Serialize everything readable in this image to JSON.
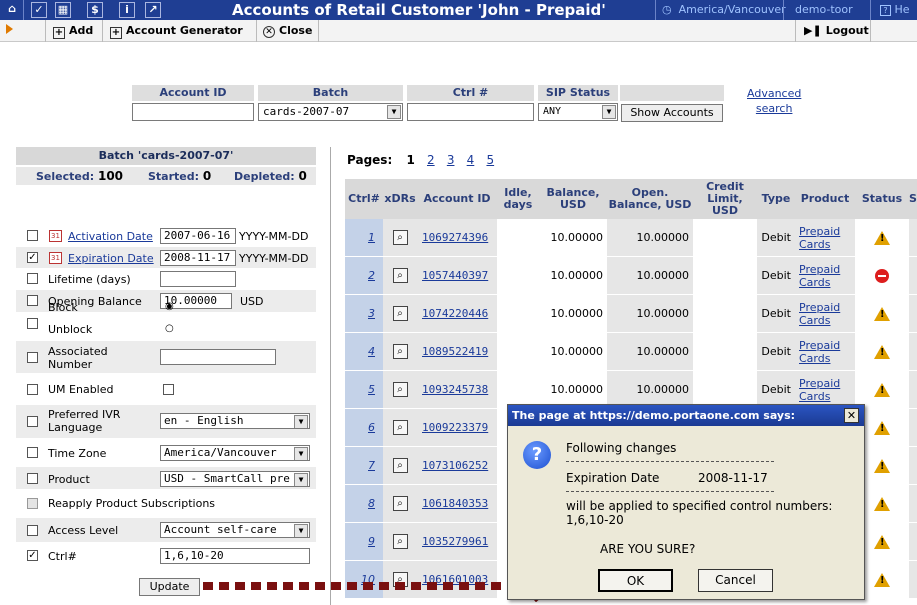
{
  "topbar": {
    "title": "Accounts of Retail Customer 'John - Prepaid'",
    "timezone": "America/Vancouver",
    "user": "demo-toor",
    "help": "He"
  },
  "toolbar": {
    "add": "Add",
    "generator": "Account Generator",
    "close": "Close",
    "logout": "Logout"
  },
  "search": {
    "account_id_label": "Account ID",
    "account_id_value": "",
    "batch_label": "Batch",
    "batch_value": "cards-2007-07",
    "ctrl_label": "Ctrl #",
    "ctrl_value": "",
    "sip_label": "SIP Status",
    "sip_value": "ANY",
    "show_button": "Show Accounts",
    "advanced_line1": "Advanced",
    "advanced_line2": "search"
  },
  "batch_panel": {
    "title": "Batch 'cards-2007-07'",
    "selected_label": "Selected:",
    "selected_value": "100",
    "started_label": "Started:",
    "started_value": "0",
    "depleted_label": "Depleted:",
    "depleted_value": "0",
    "activation_label": "Activation Date",
    "activation_value": "2007-06-16",
    "activation_format": "YYYY-MM-DD",
    "expiration_label": "Expiration Date",
    "expiration_value": "2008-11-17",
    "expiration_format": "YYYY-MM-DD",
    "lifetime_label": "Lifetime (days)",
    "lifetime_value": "",
    "opening_label": "Opening Balance",
    "opening_value": "10.00000",
    "opening_unit": "USD",
    "block_label": "Block",
    "unblock_label": "Unblock",
    "associated_label_1": "Associated",
    "associated_label_2": "Number",
    "associated_value": "",
    "um_label": "UM Enabled",
    "ivr_label_1": "Preferred IVR",
    "ivr_label_2": "Language",
    "ivr_value": "en - English",
    "tz_label": "Time Zone",
    "tz_value": "America/Vancouver",
    "product_label": "Product",
    "product_value": "USD - SmartCall pre",
    "reapply_label": "Reapply Product Subscriptions",
    "access_label": "Access Level",
    "access_value": "Account self-care",
    "ctrl_label": "Ctrl#",
    "ctrl_value": "1,6,10-20",
    "update_button": "Update"
  },
  "pagination": {
    "label": "Pages:",
    "current": "1",
    "others": [
      "2",
      "3",
      "4",
      "5"
    ]
  },
  "table": {
    "headers": {
      "ctrl": "Ctrl#",
      "xdrs": "xDRs",
      "account_id": "Account ID",
      "idle": "Idle, days",
      "balance": "Balance, USD",
      "open_balance": "Open. Balance, USD",
      "credit": "Credit Limit, USD",
      "type": "Type",
      "product": "Product",
      "status": "Status",
      "extra": "S"
    },
    "rows": [
      {
        "ctrl": "1",
        "account_id": "1069274396",
        "balance": "10.00000",
        "open_balance": "10.00000",
        "type": "Debit",
        "product_1": "Prepaid",
        "product_2": "Cards",
        "status": "warning"
      },
      {
        "ctrl": "2",
        "account_id": "1057440397",
        "balance": "10.00000",
        "open_balance": "10.00000",
        "type": "Debit",
        "product_1": "Prepaid",
        "product_2": "Cards",
        "status": "blocked"
      },
      {
        "ctrl": "3",
        "account_id": "1074220446",
        "balance": "10.00000",
        "open_balance": "10.00000",
        "type": "Debit",
        "product_1": "Prepaid",
        "product_2": "Cards",
        "status": "warning"
      },
      {
        "ctrl": "4",
        "account_id": "1089522419",
        "balance": "10.00000",
        "open_balance": "10.00000",
        "type": "Debit",
        "product_1": "Prepaid",
        "product_2": "Cards",
        "status": "warning"
      },
      {
        "ctrl": "5",
        "account_id": "1093245738",
        "balance": "10.00000",
        "open_balance": "10.00000",
        "type": "Debit",
        "product_1": "Prepaid",
        "product_2": "Cards",
        "status": "warning"
      },
      {
        "ctrl": "6",
        "account_id": "1009223379",
        "status": "warning"
      },
      {
        "ctrl": "7",
        "account_id": "1073106252",
        "status": "warning"
      },
      {
        "ctrl": "8",
        "account_id": "1061840353",
        "status": "warning"
      },
      {
        "ctrl": "9",
        "account_id": "1035279961",
        "status": "warning"
      },
      {
        "ctrl": "10",
        "account_id": "1061601003",
        "status": "warning"
      }
    ]
  },
  "dialog": {
    "title": "The page at https://demo.portaone.com says:",
    "line1": "Following changes",
    "field": "Expiration Date",
    "field_value": "2008-11-17",
    "line3": "will be applied to specified control numbers:",
    "line4": "1,6,10-20",
    "question": "ARE YOU SURE?",
    "ok": "OK",
    "cancel": "Cancel"
  },
  "colors": {
    "topbar": "#1f3e93",
    "link": "#1a3a9a",
    "warning": "#e0a000",
    "blocked": "#dd1e1e",
    "connector": "#7a1010"
  }
}
